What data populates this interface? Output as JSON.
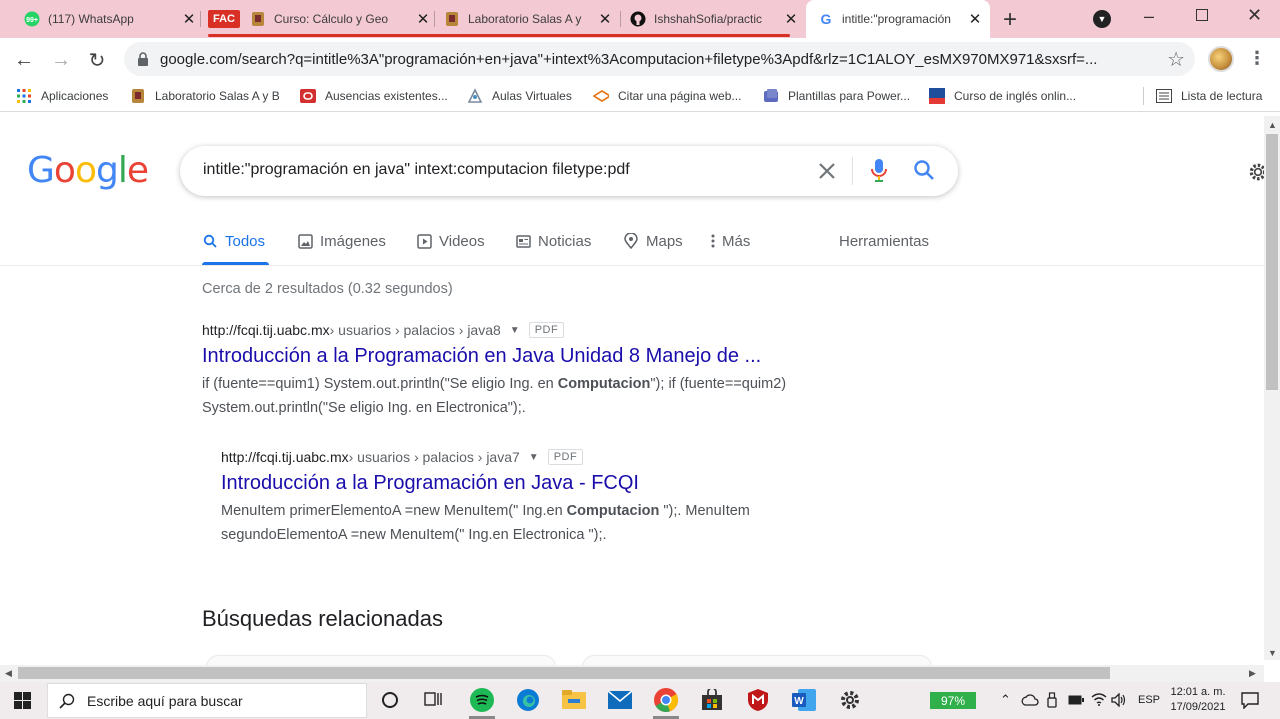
{
  "browser": {
    "tabs": [
      {
        "title": "(117) WhatsApp",
        "favicon": "whatsapp-icon"
      },
      {
        "title": "Curso: Cálculo y Geo",
        "favicon": "school-crest-icon",
        "group_label": "FAC"
      },
      {
        "title": "Laboratorio Salas A y",
        "favicon": "school-crest-icon"
      },
      {
        "title": "IshshahSofia/practic",
        "favicon": "github-icon"
      },
      {
        "title": "intitle:\"programación",
        "favicon": "google-icon",
        "active": true
      }
    ],
    "whatsapp_badge": "99+",
    "address": "google.com/search?q=intitle%3A\"programación+en+java\"+intext%3Acomputacion+filetype%3Apdf&rlz=1C1ALOY_esMX970MX971&sxsrf=...",
    "bookmarks": [
      {
        "label": "Aplicaciones",
        "icon": "apps-grid-icon"
      },
      {
        "label": "Laboratorio Salas A y B",
        "icon": "school-crest-icon"
      },
      {
        "label": "Ausencias existentes...",
        "icon": "oracle-icon"
      },
      {
        "label": "Aulas Virtuales",
        "icon": "classroom-icon"
      },
      {
        "label": "Citar una página web...",
        "icon": "citation-icon"
      },
      {
        "label": "Plantillas para Power...",
        "icon": "slides-icon"
      },
      {
        "label": "Curso de inglés onlin...",
        "icon": "course-icon"
      }
    ],
    "reading_list": "Lista de lectura"
  },
  "search": {
    "query": "intitle:\"programación en java\" intext:computacion filetype:pdf",
    "tabs": [
      {
        "label": "Todos",
        "icon": "search-icon",
        "active": true
      },
      {
        "label": "Imágenes",
        "icon": "image-icon"
      },
      {
        "label": "Videos",
        "icon": "video-icon"
      },
      {
        "label": "Noticias",
        "icon": "news-icon"
      },
      {
        "label": "Maps",
        "icon": "map-pin-icon"
      },
      {
        "label": "Más",
        "icon": "more-vert-icon"
      }
    ],
    "tools": "Herramientas",
    "stats": "Cerca de 2 resultados (0.32 segundos)",
    "results": [
      {
        "domain": "http://fcqi.tij.uabc.mx",
        "path": " › usuarios › palacios › java8",
        "badge": "PDF",
        "title": "Introducción a la Programación en Java Unidad 8 Manejo de ...",
        "snippet_a": "if (fuente==quim1) System.out.println(\"Se eligio Ing. en ",
        "snippet_b": "Computacion",
        "snippet_c": "\"); if (fuente==quim2) System.out.println(\"Se eligio Ing. en Electronica\");."
      },
      {
        "domain": "http://fcqi.tij.uabc.mx",
        "path": " › usuarios › palacios › java7",
        "badge": "PDF",
        "title": "Introducción a la Programación en Java - FCQI",
        "snippet_a": "MenuItem primerElementoA =new MenuItem(\" Ing.en ",
        "snippet_b": "Computacion",
        "snippet_c": " \");. MenuItem segundoElementoA =new MenuItem(\" Ing.en Electronica \");."
      }
    ],
    "related_heading": "Búsquedas relacionadas"
  },
  "taskbar": {
    "search_placeholder": "Escribe aquí para buscar",
    "battery": "97%",
    "language": "ESP",
    "time": "12:01 a. m.",
    "date": "17/09/2021"
  },
  "colors": {
    "tabstrip": "#f3c9d3",
    "link": "#1a0dab",
    "accent": "#1a73e8",
    "battery": "#2fb04a"
  }
}
